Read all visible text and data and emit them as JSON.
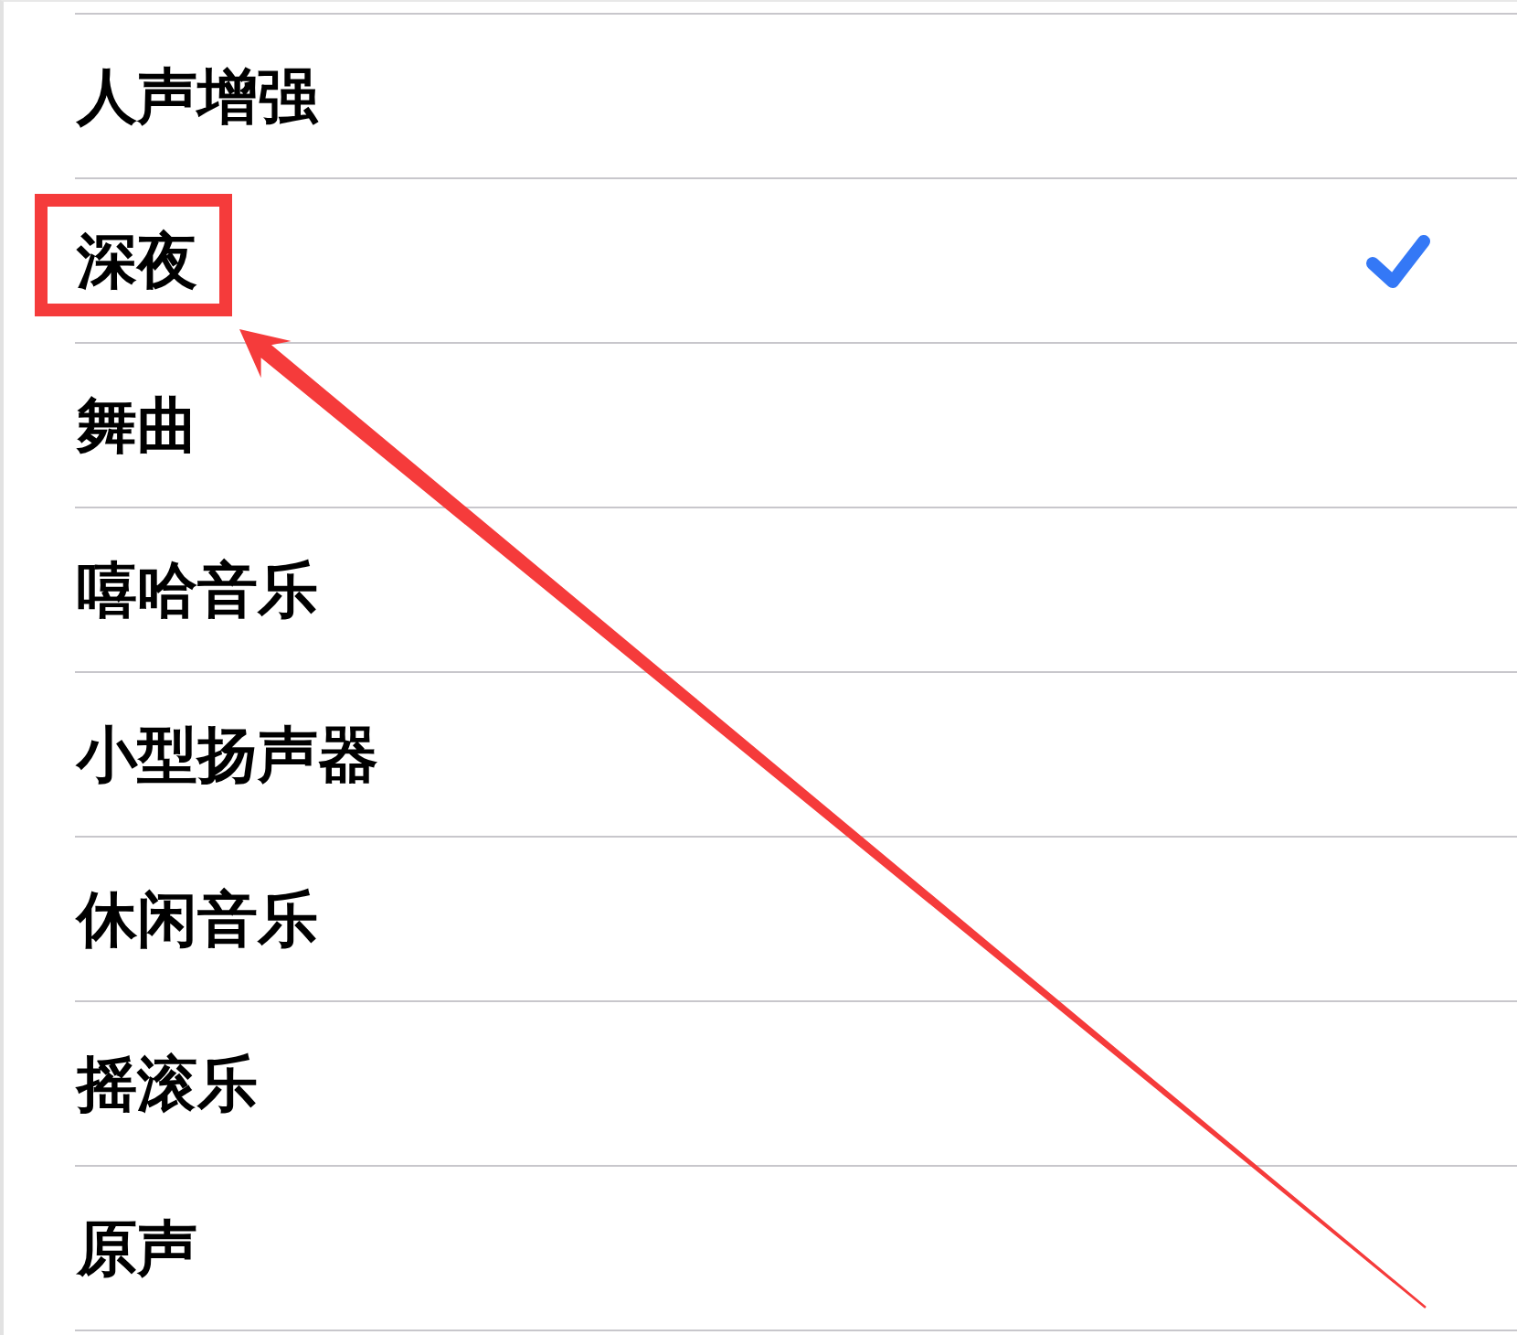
{
  "options": [
    {
      "label": "人声增强",
      "selected": false,
      "highlighted": false
    },
    {
      "label": "深夜",
      "selected": true,
      "highlighted": true
    },
    {
      "label": "舞曲",
      "selected": false,
      "highlighted": false
    },
    {
      "label": "嘻哈音乐",
      "selected": false,
      "highlighted": false
    },
    {
      "label": "小型扬声器",
      "selected": false,
      "highlighted": false
    },
    {
      "label": "休闲音乐",
      "selected": false,
      "highlighted": false
    },
    {
      "label": "摇滚乐",
      "selected": false,
      "highlighted": false
    },
    {
      "label": "原声",
      "selected": false,
      "highlighted": false
    }
  ]
}
